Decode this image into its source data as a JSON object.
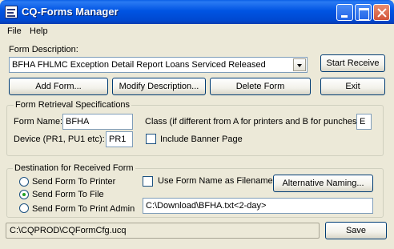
{
  "window": {
    "title": "CQ-Forms Manager"
  },
  "menu": {
    "items": [
      "File",
      "Help"
    ]
  },
  "form_description": {
    "label": "Form Description:",
    "selected": "BFHA FHLMC Exception Detail Report Loans Serviced Released"
  },
  "buttons": {
    "start_receive": "Start Receive",
    "add_form": "Add Form...",
    "modify_description": "Modify Description...",
    "delete_form": "Delete Form",
    "exit": "Exit",
    "alternative_naming": "Alternative Naming...",
    "save": "Save"
  },
  "retrieval": {
    "group_title": "Form Retrieval Specifications",
    "form_name_label": "Form Name:",
    "form_name_value": "BFHA",
    "class_label": "Class (if different from A for printers and B for punches):",
    "class_value": "E",
    "device_label": "Device (PR1, PU1 etc):",
    "device_value": "PR1",
    "include_banner_label": "Include Banner Page",
    "include_banner_checked": false
  },
  "destination": {
    "group_title": "Destination for Received Form",
    "options": [
      "Send Form To Printer",
      "Send Form To File",
      "Send Form To Print Admin"
    ],
    "selected_index": 1,
    "use_form_name_label": "Use Form Name as Filename",
    "use_form_name_checked": false,
    "file_path": "C:\\Download\\BFHA.txt<2-day>"
  },
  "status": {
    "config_path": "C:\\CQPROD\\CQFormCfg.ucq"
  }
}
